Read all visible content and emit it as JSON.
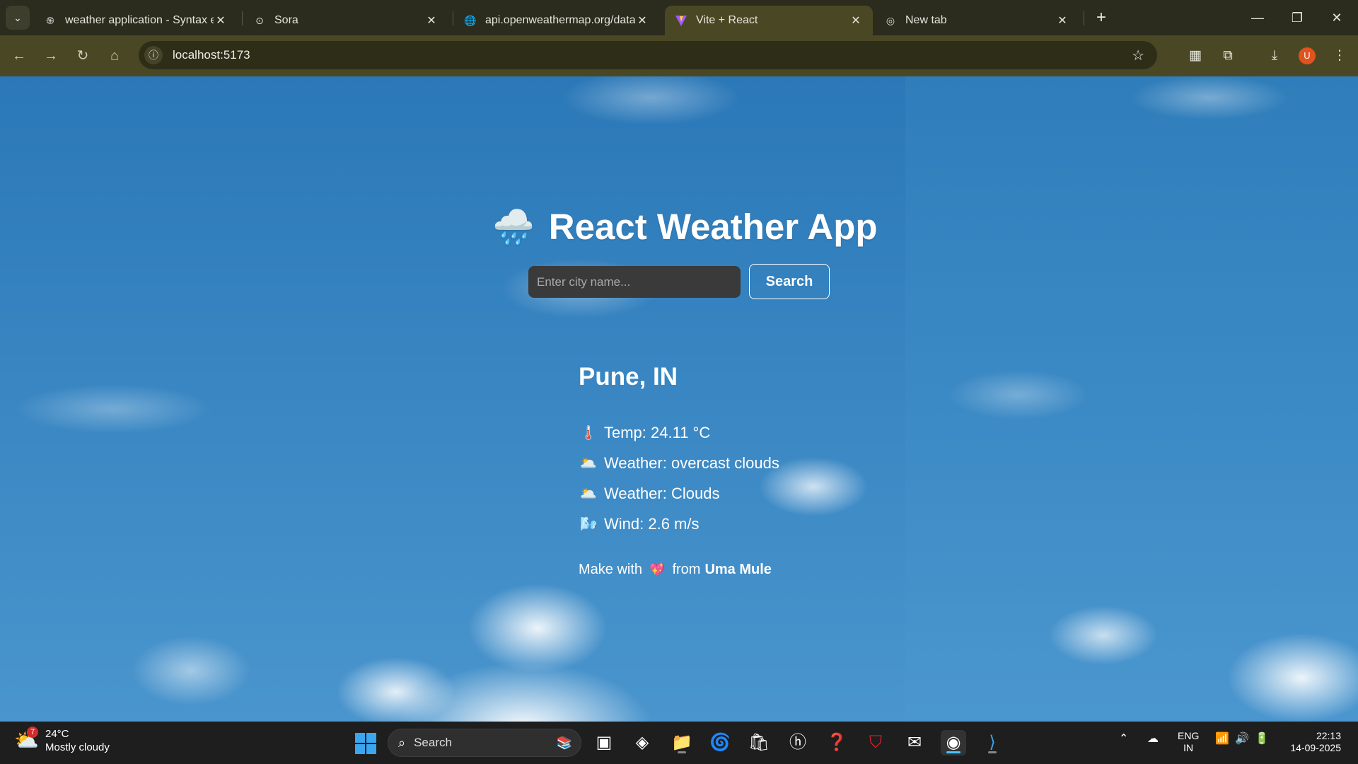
{
  "browser": {
    "tabs": [
      {
        "title": "weather application - Syntax er",
        "icon": "openai-icon",
        "active": false
      },
      {
        "title": "Sora",
        "icon": "sora-icon",
        "active": false
      },
      {
        "title": "api.openweathermap.org/data/",
        "icon": "globe-icon",
        "active": false
      },
      {
        "title": "Vite + React",
        "icon": "vite-icon",
        "active": true
      },
      {
        "title": "New tab",
        "icon": "chrome-icon",
        "active": false
      }
    ],
    "tab_close_glyph": "✕",
    "new_tab_glyph": "+",
    "url": "localhost:5173",
    "profile_initial": "U",
    "profile_color": "#e0521e"
  },
  "app": {
    "title": "React Weather App",
    "title_icon": "🌧️",
    "search": {
      "placeholder": "Enter city name...",
      "value": "",
      "button_label": "Search"
    },
    "result": {
      "city": "Pune, IN",
      "details": [
        {
          "icon": "🌡️",
          "icon_name": "thermometer-icon",
          "text": "Temp: 24.11 °C"
        },
        {
          "icon": "🌥️",
          "icon_name": "sun-behind-cloud-icon",
          "text": "Weather: overcast clouds"
        },
        {
          "icon": "🌥️",
          "icon_name": "sun-behind-cloud-icon",
          "text": "Weather: Clouds"
        },
        {
          "icon": "🌬️",
          "icon_name": "wind-icon",
          "text": "Wind: 2.6 m/s"
        }
      ]
    },
    "footer": {
      "prefix": "Make with",
      "heart": "💖",
      "middle": "from",
      "author": "Uma Mule"
    }
  },
  "taskbar": {
    "weather": {
      "temp": "24°C",
      "condition": "Mostly cloudy",
      "badge": "7"
    },
    "search_label": "Search",
    "language": {
      "line1": "ENG",
      "line2": "IN"
    },
    "clock": {
      "time": "22:13",
      "date": "14-09-2025"
    }
  },
  "colors": {
    "sky_top": "#2b78b8",
    "sky_bottom": "#4a95cd",
    "input_bg": "#3a3a3a",
    "browser_chrome": "#4a4824",
    "tabstrip": "#2b2b1e",
    "taskbar": "#1e1e1e"
  }
}
